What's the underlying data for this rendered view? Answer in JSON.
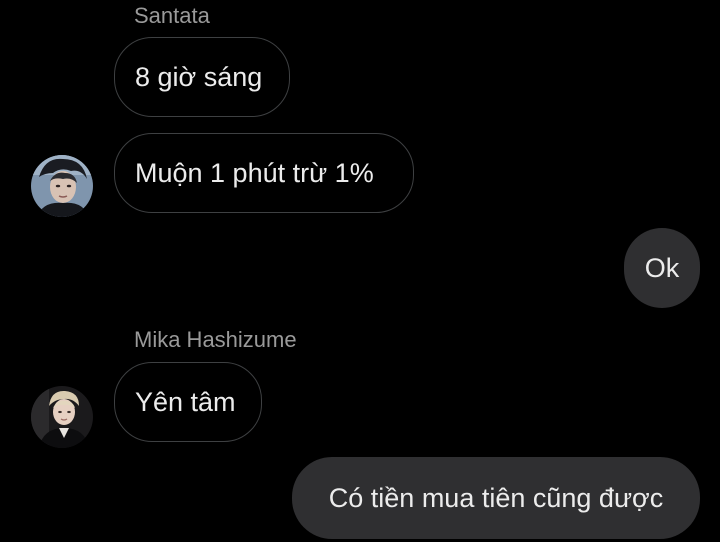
{
  "conversation": {
    "messages": [
      {
        "sender": "Santata",
        "text": "8 giờ sáng",
        "direction": "incoming"
      },
      {
        "sender": "Santata",
        "text": "Muộn 1 phút trừ 1%",
        "direction": "incoming",
        "avatar": "avatar-santata"
      },
      {
        "sender": "me",
        "text": "Ok",
        "direction": "outgoing"
      },
      {
        "sender": "Mika Hashizume",
        "text": "Yên tâm",
        "direction": "incoming",
        "avatar": "avatar-mika"
      },
      {
        "sender": "me",
        "text": "Có tiền mua tiên cũng được",
        "direction": "outgoing"
      }
    ],
    "sender_labels": {
      "santata": "Santata",
      "mika": "Mika Hashizume"
    }
  },
  "theme": {
    "background": "#000000",
    "incoming_border": "#3e4042",
    "outgoing_bubble": "#2f2f31",
    "text": "#ececec",
    "sender_label": "#9a9a9a"
  }
}
